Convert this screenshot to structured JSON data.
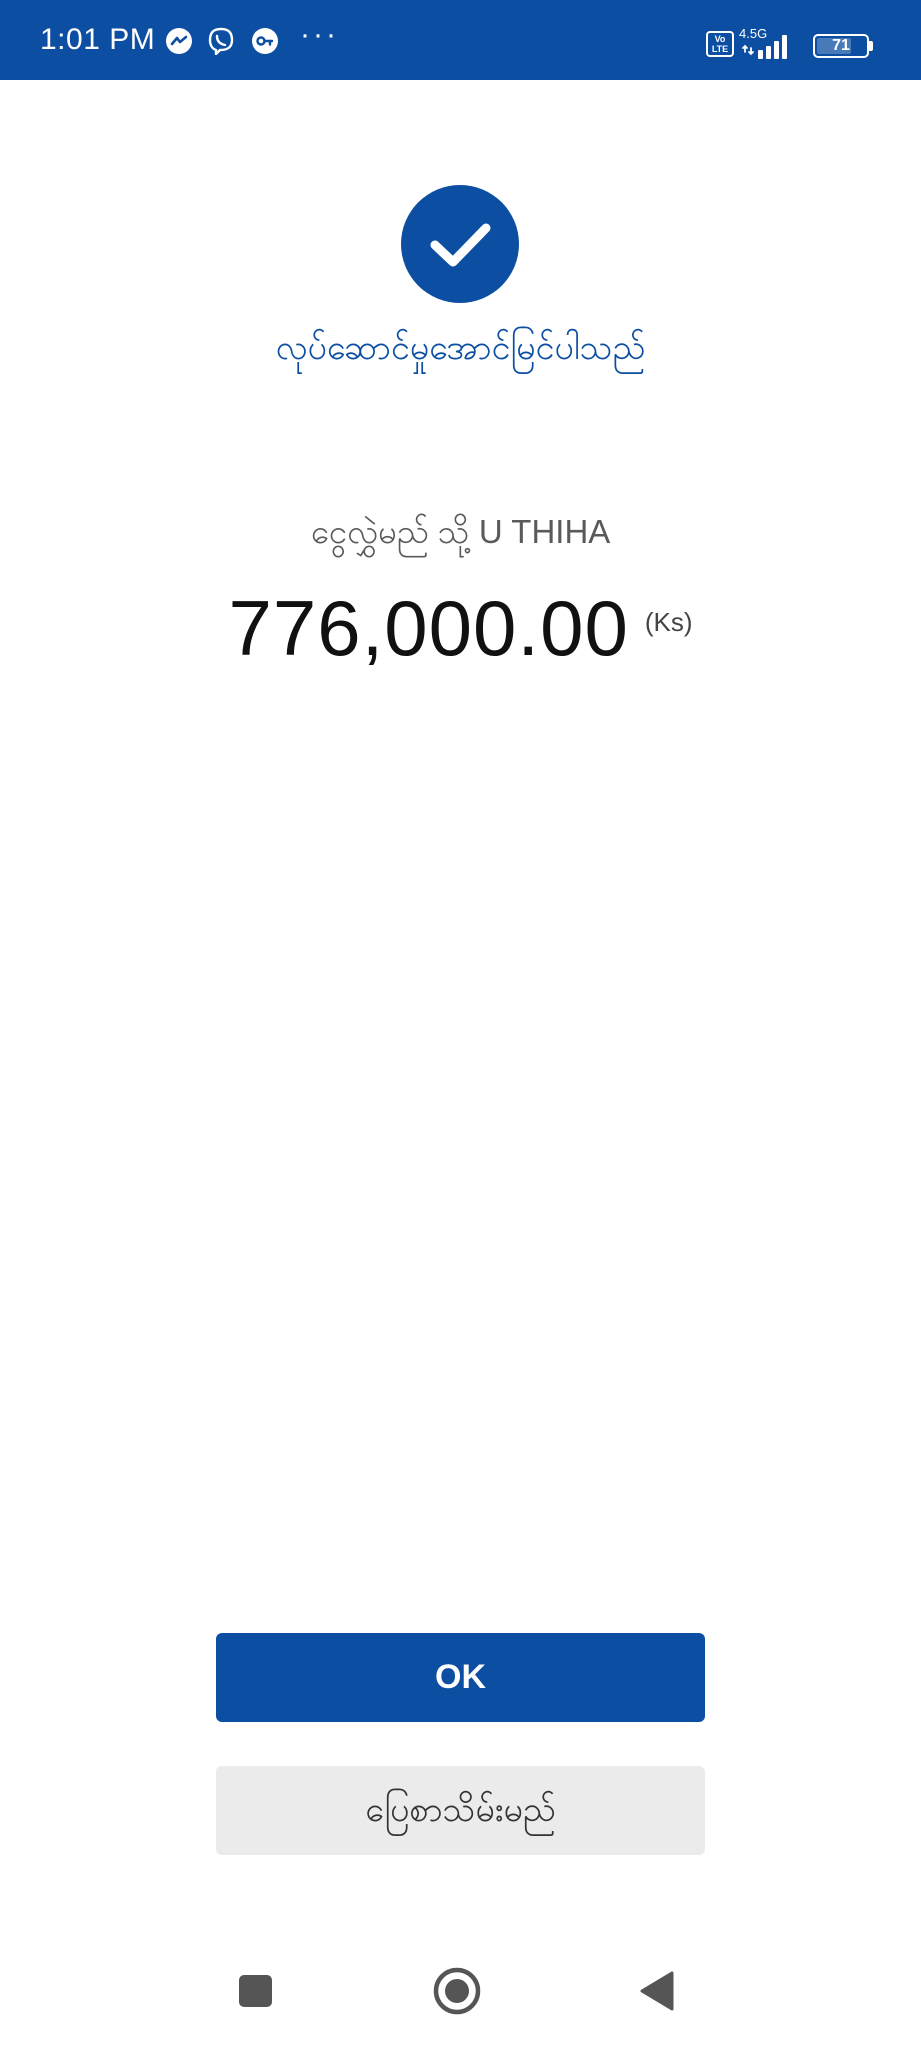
{
  "status_bar": {
    "time": "1:01 PM",
    "icons": [
      "messenger-icon",
      "viber-icon",
      "vpn-key-icon"
    ],
    "more": "···",
    "volte": "Vo LTE",
    "network": "4.5G",
    "battery_level": "71",
    "color": "#0b4ea2"
  },
  "result": {
    "icon": "check-icon",
    "title": "လုပ်ဆောင်မှုအောင်မြင်ပါသည်",
    "recipient_text": "ငွေလွှဲမည် သို့ U THIHA",
    "amount": "776,000.00",
    "currency": "(Ks)"
  },
  "buttons": {
    "ok_label": "OK",
    "save_receipt_label": "ပြေစာသိမ်းမည်"
  },
  "nav_bar": {
    "icons": [
      "recents-icon",
      "home-icon",
      "back-icon"
    ]
  },
  "colors": {
    "brand_blue": "#0b4ea2",
    "secondary_button": "#ebebeb",
    "text_dark": "#111111",
    "text_muted": "#5a5a5a"
  }
}
